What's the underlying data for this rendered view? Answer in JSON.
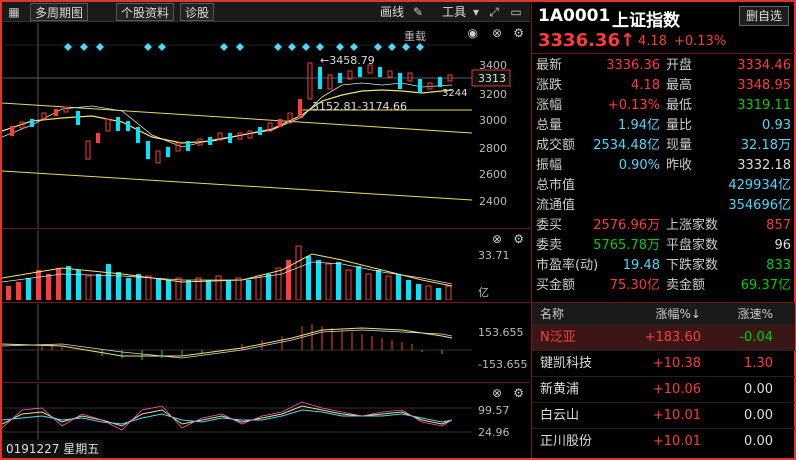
{
  "toolbar": {
    "period": "多周期图",
    "info": "个股资料",
    "diagnose": "诊股",
    "draw": "画线",
    "tools": "工具",
    "restore": "重载"
  },
  "main_chart": {
    "y_ticks": [
      "3400",
      "3200",
      "3000",
      "2800",
      "2600",
      "2400"
    ],
    "current_label": "3313",
    "low_label": "3244",
    "high_annot": "←3458.79",
    "range_annot": "3152.81-3174.66"
  },
  "volume_pane": {
    "top_label": "33.71",
    "unit": "亿"
  },
  "macd_pane": {
    "top": "153.655",
    "bottom": "-153.655"
  },
  "kdj_pane": {
    "top": "99.57",
    "bottom": "24.96"
  },
  "date_bar": "0191227 星期五",
  "colors": {
    "up": "#ff3b3b",
    "down": "#00e5ff",
    "ma": "#f2e36b",
    "border": "#e0352b"
  },
  "quote": {
    "code": "1A0001",
    "name": "上证指数",
    "delete_button": "删自选",
    "price": "3336.36",
    "arrow": "up",
    "change": "4.18",
    "pct": "+0.13%",
    "rows": [
      {
        "l1": "最新",
        "v1": "3336.36",
        "c1": "red",
        "l2": "开盘",
        "v2": "3334.46",
        "c2": "red"
      },
      {
        "l1": "涨跌",
        "v1": "4.18",
        "c1": "red",
        "l2": "最高",
        "v2": "3348.95",
        "c2": "red"
      },
      {
        "l1": "涨幅",
        "v1": "+0.13%",
        "c1": "red",
        "l2": "最低",
        "v2": "3319.11",
        "c2": "green"
      },
      {
        "l1": "总量",
        "v1": "1.94亿",
        "c1": "cyan",
        "l2": "量比",
        "v2": "0.93",
        "c2": "cyan"
      },
      {
        "l1": "成交额",
        "v1": "2534.48亿",
        "c1": "cyan",
        "l2": "现量",
        "v2": "32.18万",
        "c2": "cyan"
      },
      {
        "l1": "振幅",
        "v1": "0.90%",
        "c1": "cyan",
        "l2": "昨收",
        "v2": "3332.18",
        "c2": "white"
      },
      {
        "l1": "总市值",
        "v1": "",
        "c1": "white",
        "l2": "",
        "v2": "429934亿",
        "c2": "cyan"
      },
      {
        "l1": "流通值",
        "v1": "",
        "c1": "white",
        "l2": "",
        "v2": "354696亿",
        "c2": "cyan"
      },
      {
        "l1": "委买",
        "v1": "2576.96万",
        "c1": "red",
        "l2": "上涨家数",
        "v2": "857",
        "c2": "red"
      },
      {
        "l1": "委卖",
        "v1": "5765.78万",
        "c1": "green",
        "l2": "平盘家数",
        "v2": "96",
        "c2": "white"
      },
      {
        "l1": "市盈率(动)",
        "v1": "19.48",
        "c1": "cyan",
        "l2": "下跌家数",
        "v2": "833",
        "c2": "green"
      },
      {
        "l1": "买金额",
        "v1": "75.30亿",
        "c1": "red",
        "l2": "卖金额",
        "v2": "69.37亿",
        "c2": "green"
      }
    ]
  },
  "list": {
    "headers": {
      "name": "名称",
      "pct": "涨幅%↓",
      "speed": "涨速%"
    },
    "rows": [
      {
        "name": "N泛亚",
        "pct": "+183.60",
        "speed": "-0.04",
        "speed_color": "green"
      },
      {
        "name": "键凯科技",
        "pct": "+10.38",
        "speed": "1.30",
        "speed_color": "red"
      },
      {
        "name": "新黄浦",
        "pct": "+10.06",
        "speed": "0.00",
        "speed_color": "white"
      },
      {
        "name": "白云山",
        "pct": "+10.01",
        "speed": "0.00",
        "speed_color": "white"
      },
      {
        "name": "正川股份",
        "pct": "+10.01",
        "speed": "0.00",
        "speed_color": "white"
      }
    ]
  }
}
